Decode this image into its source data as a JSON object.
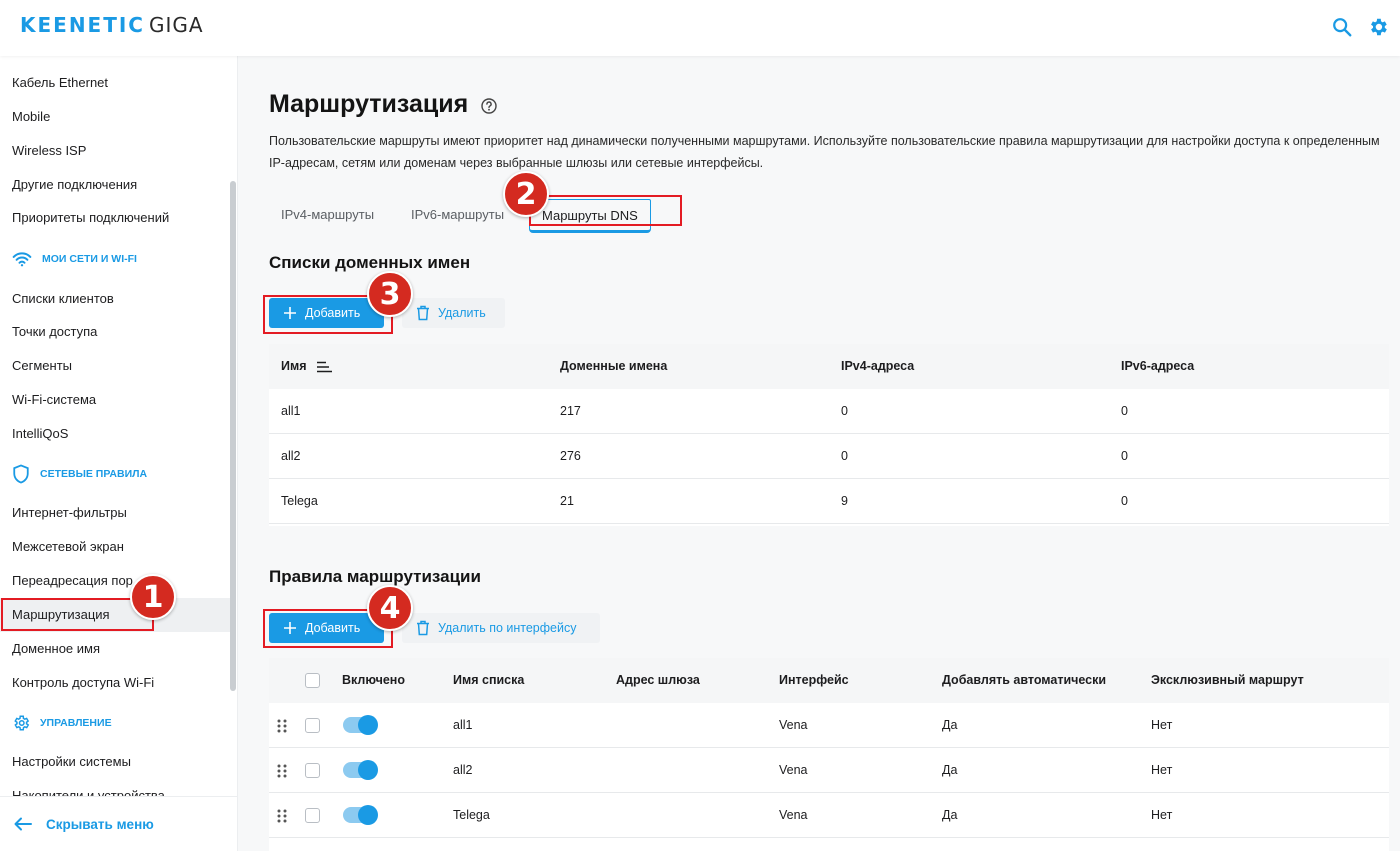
{
  "header": {
    "brand": "KEENETIC",
    "model": "GIGA",
    "search_icon": "search-icon",
    "settings_icon": "gear-icon"
  },
  "sidebar": {
    "items_top": [
      "Кабель Ethernet",
      "Mobile",
      "Wireless ISP",
      "Другие подключения",
      "Приоритеты подключений"
    ],
    "section_networks": "МОИ СЕТИ И WI-FI",
    "items_networks": [
      "Списки клиентов",
      "Точки доступа",
      "Сегменты",
      "Wi-Fi-система",
      "IntelliQoS"
    ],
    "section_rules": "СЕТЕВЫЕ ПРАВИЛА",
    "items_rules": [
      "Интернет-фильтры",
      "Межсетевой экран",
      "Переадресация пор",
      "Маршрутизация",
      "Доменное имя",
      "Контроль доступа Wi-Fi"
    ],
    "section_manage": "УПРАВЛЕНИЕ",
    "items_manage": [
      "Настройки системы",
      "Накопители и устройства"
    ],
    "footer": "Скрывать меню"
  },
  "page": {
    "title": "Маршрутизация",
    "description": "Пользовательские маршруты имеют приоритет над динамически полученными маршрутами. Используйте пользовательские правила маршрутизации для настройки доступа к определенным IP-адресам, сетям или доменам через выбранные шлюзы или сетевые интерфейсы.",
    "tabs": [
      "IPv4-маршруты",
      "IPv6-маршруты",
      "Маршруты DNS"
    ]
  },
  "domain_lists": {
    "title": "Списки доменных имен",
    "add_label": "Добавить",
    "delete_label": "Удалить",
    "columns": [
      "Имя",
      "Доменные имена",
      "IPv4-адреса",
      "IPv6-адреса"
    ],
    "rows": [
      [
        "all1",
        "217",
        "0",
        "0"
      ],
      [
        "all2",
        "276",
        "0",
        "0"
      ],
      [
        "Telega",
        "21",
        "9",
        "0"
      ]
    ]
  },
  "routing_rules": {
    "title": "Правила маршрутизации",
    "add_label": "Добавить",
    "delete_label": "Удалить по интерфейсу",
    "columns": [
      "Включено",
      "Имя списка",
      "Адрес шлюза",
      "Интерфейс",
      "Добавлять автоматически",
      "Эксклюзивный маршрут"
    ],
    "rows": [
      {
        "enabled": true,
        "list": "all1",
        "gateway": "",
        "iface": "Vena",
        "auto": "Да",
        "exclusive": "Нет"
      },
      {
        "enabled": true,
        "list": "all2",
        "gateway": "",
        "iface": "Vena",
        "auto": "Да",
        "exclusive": "Нет"
      },
      {
        "enabled": true,
        "list": "Telega",
        "gateway": "",
        "iface": "Vena",
        "auto": "Да",
        "exclusive": "Нет"
      }
    ]
  },
  "annotations": [
    "1",
    "2",
    "3",
    "4"
  ],
  "colors": {
    "accent": "#1a9ae4",
    "marker": "#e31b23",
    "badge": "#d42a20"
  }
}
